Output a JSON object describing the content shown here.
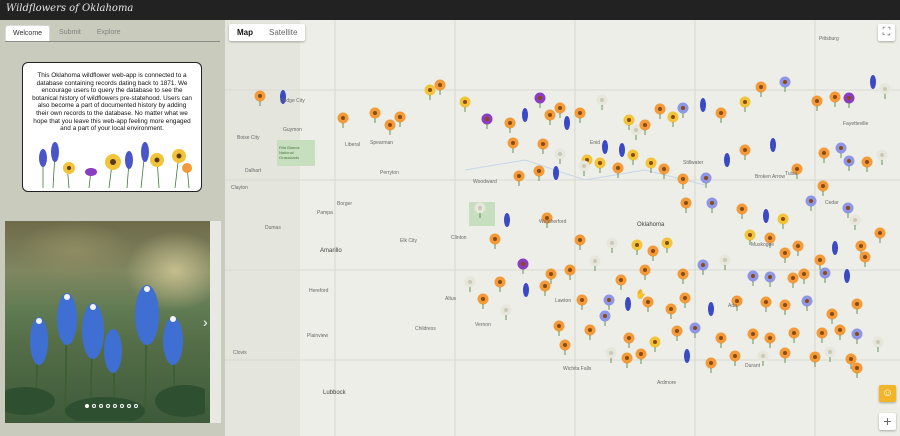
{
  "app": {
    "title": "Wildflowers of Oklahoma"
  },
  "tabs": [
    {
      "label": "Welcome",
      "active": true
    },
    {
      "label": "Submit",
      "active": false
    },
    {
      "label": "Explore",
      "active": false
    }
  ],
  "intro": {
    "text": "This Oklahoma wildflower web-app is connected to a database containing records dating back to 1871. We encourage users to query the database to see the botanical history of wildflowers pre-statehood. Users can also become a part of documented history by adding their own records to the database. No matter what we hope that you leave this web-app feeling more engaged and a part of your local environment."
  },
  "carousel": {
    "slide_count": 8,
    "active_index": 0,
    "next_icon": "chevron-right-icon"
  },
  "map": {
    "type_buttons": [
      {
        "label": "Map",
        "active": true
      },
      {
        "label": "Satellite",
        "active": false
      }
    ],
    "fullscreen_icon": "fullscreen-icon",
    "pegman_icon": "pegman-icon",
    "zoom_in_label": "+",
    "places": [
      {
        "name": "Oklahoma",
        "big": true
      },
      {
        "name": "Amarillo",
        "big": true
      },
      {
        "name": "Lubbock",
        "big": true
      },
      {
        "name": "Wichita Falls",
        "big": false
      },
      {
        "name": "Lawton",
        "big": false
      },
      {
        "name": "Tulsa",
        "big": false
      },
      {
        "name": "Broken Arrow",
        "big": false
      },
      {
        "name": "Pittsburg",
        "big": false
      },
      {
        "name": "Weatherford",
        "big": false
      },
      {
        "name": "Enid",
        "big": false
      },
      {
        "name": "Stillwater",
        "big": false
      },
      {
        "name": "Dodge City",
        "big": false
      },
      {
        "name": "Guymon",
        "big": false
      },
      {
        "name": "Liberal",
        "big": false
      },
      {
        "name": "Woodward",
        "big": false
      },
      {
        "name": "Clinton",
        "big": false
      },
      {
        "name": "Altus",
        "big": false
      },
      {
        "name": "Vernon",
        "big": false
      },
      {
        "name": "Dalhart",
        "big": false
      },
      {
        "name": "Pampa",
        "big": false
      },
      {
        "name": "Borger",
        "big": false
      },
      {
        "name": "Hereford",
        "big": false
      },
      {
        "name": "Plainview",
        "big": false
      },
      {
        "name": "Childress",
        "big": false
      },
      {
        "name": "Muskogee",
        "big": false
      },
      {
        "name": "Fayetteville",
        "big": false
      },
      {
        "name": "Ada",
        "big": false
      },
      {
        "name": "Durant",
        "big": false
      },
      {
        "name": "Ardmore",
        "big": false
      },
      {
        "name": "Spearman",
        "big": false
      },
      {
        "name": "Dumas",
        "big": false
      },
      {
        "name": "Clovis",
        "big": false
      },
      {
        "name": "Clayton",
        "big": false
      },
      {
        "name": "Boise City",
        "big": false
      },
      {
        "name": "Perryton",
        "big": false
      },
      {
        "name": "Elk City",
        "big": false
      },
      {
        "name": "Cedar",
        "big": false
      },
      {
        "name": "Rita Blanca National Grasslands",
        "big": false
      }
    ],
    "marker_colors": {
      "orange": "#f39a3a",
      "yellow": "#f2c43a",
      "blue": "#3b49c4",
      "purple": "#8a3cc2",
      "lavender": "#8f96e6",
      "white": "#e6e6dd"
    }
  }
}
